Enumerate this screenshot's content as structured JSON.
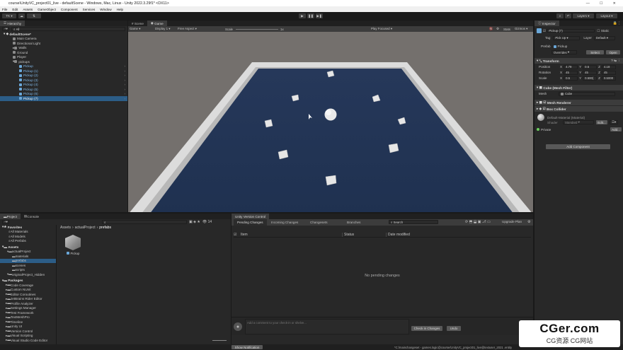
{
  "window": {
    "title": "course\\UnityVC_project01_live - defaultScene - Windows, Mac, Linux - Unity 2022.3.29f1* <DX11>"
  },
  "menu": [
    "File",
    "Edit",
    "Assets",
    "GameObject",
    "Component",
    "Services",
    "Window",
    "Help"
  ],
  "toolbar": {
    "account": "TK",
    "layers": "Layers",
    "layout": "Layout"
  },
  "hierarchy": {
    "tab": "Hierarchy",
    "search_placeholder": "All",
    "scene": "defaultScene*",
    "items": [
      {
        "label": "Main Camera",
        "indent": 2
      },
      {
        "label": "Directional Light",
        "indent": 2
      },
      {
        "label": "Walls",
        "indent": 2
      },
      {
        "label": "Ground",
        "indent": 2
      },
      {
        "label": "Player",
        "indent": 2
      },
      {
        "label": "pickups",
        "indent": 2
      },
      {
        "label": "Pickup",
        "indent": 3
      },
      {
        "label": "Pickup (1)",
        "indent": 3
      },
      {
        "label": "Pickup (2)",
        "indent": 3
      },
      {
        "label": "Pickup (3)",
        "indent": 3
      },
      {
        "label": "Pickup (4)",
        "indent": 3
      },
      {
        "label": "Pickup (5)",
        "indent": 3
      },
      {
        "label": "Pickup (6)",
        "indent": 3
      },
      {
        "label": "Pickup (7)",
        "indent": 3
      }
    ]
  },
  "viewtabs": {
    "scene": "Scene",
    "game": "Game"
  },
  "gamebar": {
    "mode": "Game",
    "display": "Display 1",
    "aspect": "Free Aspect",
    "scale_label": "Scale",
    "scale_value": "1x",
    "play": "Play Focused",
    "stats": "Stats",
    "gizmos": "Gizmos"
  },
  "inspector": {
    "tab": "Inspector",
    "name": "Pickup (7)",
    "static": "Static",
    "tag_label": "Tag",
    "tag": "Pick Up",
    "layer_label": "Layer",
    "layer": "Default",
    "prefab_label": "Prefab",
    "prefab": "Pickup",
    "overrides": "Overrides",
    "select": "Select",
    "open": "Open",
    "transform": {
      "title": "Transform",
      "position": {
        "label": "Position",
        "x": "4.79",
        "y": "0.5",
        "z": "4.18"
      },
      "rotation": {
        "label": "Rotation",
        "x": "45",
        "y": "45",
        "z": "45"
      },
      "scale": {
        "label": "Scale",
        "x": "0.5",
        "y": "0.500(",
        "z": "0.5000"
      }
    },
    "meshfilter": {
      "title": "Cube (Mesh Filter)",
      "mesh_label": "Mesh",
      "mesh": "Cube"
    },
    "meshrenderer": "Mesh Renderer",
    "boxcollider": "Box Collider",
    "material": {
      "name": "Default-Material (Material)",
      "shader_label": "Shader",
      "shader": "Standard",
      "edit": "Edit..."
    },
    "private": "Private",
    "add": "Add...",
    "add_component": "Add Component"
  },
  "project": {
    "tabs": [
      "Project",
      "Console"
    ],
    "breadcrumb": [
      "Assets",
      "actualProject",
      "prefabs"
    ],
    "favorites": "Favorites",
    "fav_items": [
      "All Materials",
      "All Models",
      "All Prefabs"
    ],
    "assets": "Assets",
    "asset_items": [
      {
        "label": "actualProject",
        "indent": 1
      },
      {
        "label": "materials",
        "indent": 2
      },
      {
        "label": "prefabs",
        "indent": 2
      },
      {
        "label": "scenes",
        "indent": 2
      },
      {
        "label": "scripts",
        "indent": 2
      },
      {
        "label": "originalProject_Hidden",
        "indent": 1
      }
    ],
    "packages": "Packages",
    "package_items": [
      "Code Coverage",
      "Custom NUnit",
      "Editor Coroutines",
      "JetBrains Rider Editor",
      "Profile Analyzer",
      "Settings Manager",
      "Test Framework",
      "TextMeshPro",
      "Timeline",
      "Unity UI",
      "Version Control",
      "Visual Scripting",
      "Visual Studio Code Editor"
    ],
    "asset_name": "Pickup",
    "count": "14"
  },
  "vc": {
    "title": "Unity Version Control",
    "tabs": [
      "Pending Changes",
      "Incoming Changes",
      "Changesets",
      "Branches"
    ],
    "search_placeholder": "Search",
    "upgrade": "Upgrade Plan",
    "columns": [
      "Item",
      "Status",
      "Date modified"
    ],
    "empty": "No pending changes",
    "comment_placeholder": "Add a comment to your check-in or shelve...",
    "checkin": "Check in Changes",
    "undo": "Undo"
  },
  "statusbar": {
    "notification": "Show Notification",
    "path": "*C:/mainchangeset - games.logic@course/UnityVC_project01_live@textuser_2021 .entity"
  },
  "watermark": {
    "brand": "CGer.com",
    "sub": "CG资源 CG网站"
  }
}
